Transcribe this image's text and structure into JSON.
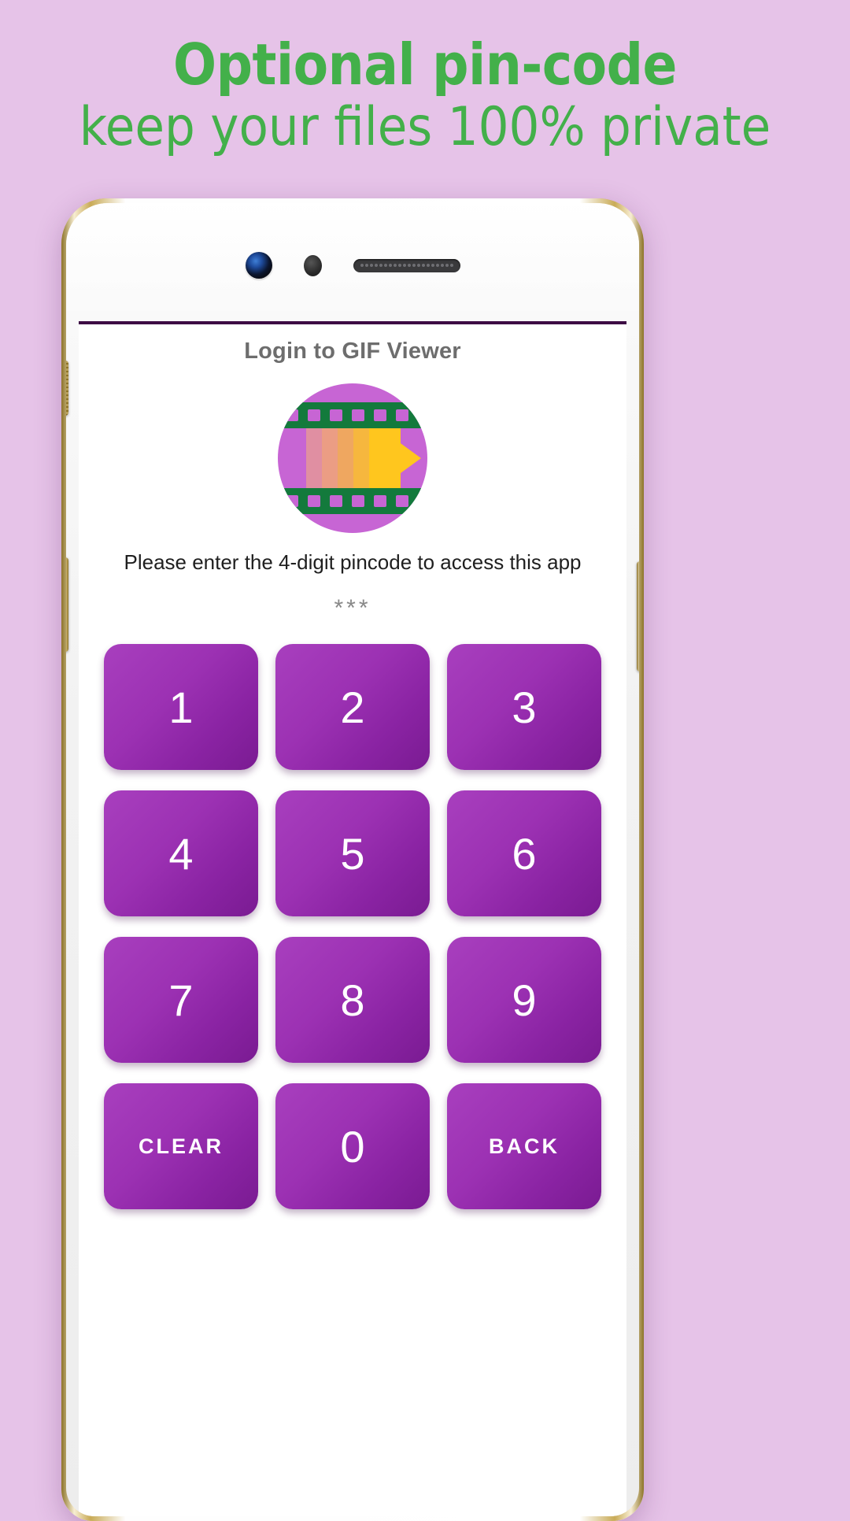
{
  "promo": {
    "line1": "Optional pin-code",
    "line2": "keep your files 100% private",
    "text_color": "#43b04a",
    "background_color": "#e6c3e8"
  },
  "device": {
    "type": "white-gold-smartphone",
    "camera": "front-camera",
    "sensor": "proximity-sensor",
    "speaker": "earpiece-speaker"
  },
  "app": {
    "title": "Login to GIF Viewer",
    "icon_name": "gif-viewer-app-icon",
    "hint": "Please enter the 4-digit pincode to access this app",
    "pin_display": "***",
    "accent_color": "#9c31b3",
    "icon_colors": {
      "circle": "#c765d4",
      "film": "#137a3c",
      "play": "#ffc61e"
    },
    "keypad": [
      {
        "label": "1",
        "name": "key-1",
        "kind": "digit"
      },
      {
        "label": "2",
        "name": "key-2",
        "kind": "digit"
      },
      {
        "label": "3",
        "name": "key-3",
        "kind": "digit"
      },
      {
        "label": "4",
        "name": "key-4",
        "kind": "digit"
      },
      {
        "label": "5",
        "name": "key-5",
        "kind": "digit"
      },
      {
        "label": "6",
        "name": "key-6",
        "kind": "digit"
      },
      {
        "label": "7",
        "name": "key-7",
        "kind": "digit"
      },
      {
        "label": "8",
        "name": "key-8",
        "kind": "digit"
      },
      {
        "label": "9",
        "name": "key-9",
        "kind": "digit"
      },
      {
        "label": "CLEAR",
        "name": "key-clear",
        "kind": "word"
      },
      {
        "label": "0",
        "name": "key-0",
        "kind": "digit"
      },
      {
        "label": "BACK",
        "name": "key-back",
        "kind": "word"
      }
    ]
  }
}
